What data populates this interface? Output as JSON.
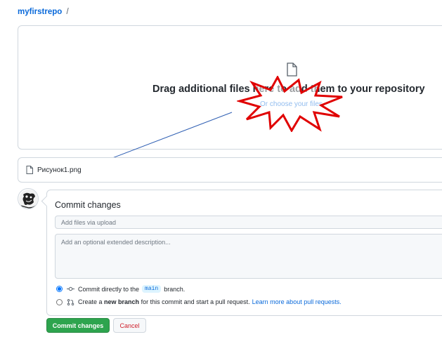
{
  "breadcrumb": {
    "repo": "myfirstrepo",
    "separator": "/"
  },
  "dropzone": {
    "title": "Drag additional files here to add them to your repository",
    "choose_link": "Or choose your files",
    "icon": "file-icon"
  },
  "file_list": {
    "items": [
      {
        "name": "Рисунок1.png",
        "icon": "file-icon"
      }
    ]
  },
  "commit": {
    "title": "Commit changes",
    "summary_placeholder": "Add files via upload",
    "description_placeholder": "Add an optional extended description...",
    "option_direct": {
      "prefix": "Commit directly to the",
      "branch": "main",
      "suffix": "branch.",
      "selected": true
    },
    "option_new_branch": {
      "prefix": "Create a",
      "bold": "new branch",
      "suffix": "for this commit and start a pull request.",
      "link": "Learn more about pull requests.",
      "selected": false
    },
    "commit_button": "Commit changes",
    "cancel_button": "Cancel"
  },
  "colors": {
    "accent": "#0969da",
    "primary_button": "#2da44e",
    "danger": "#cf222e",
    "annotation_star": "#e00000",
    "annotation_arrow": "#2f5fb3"
  }
}
